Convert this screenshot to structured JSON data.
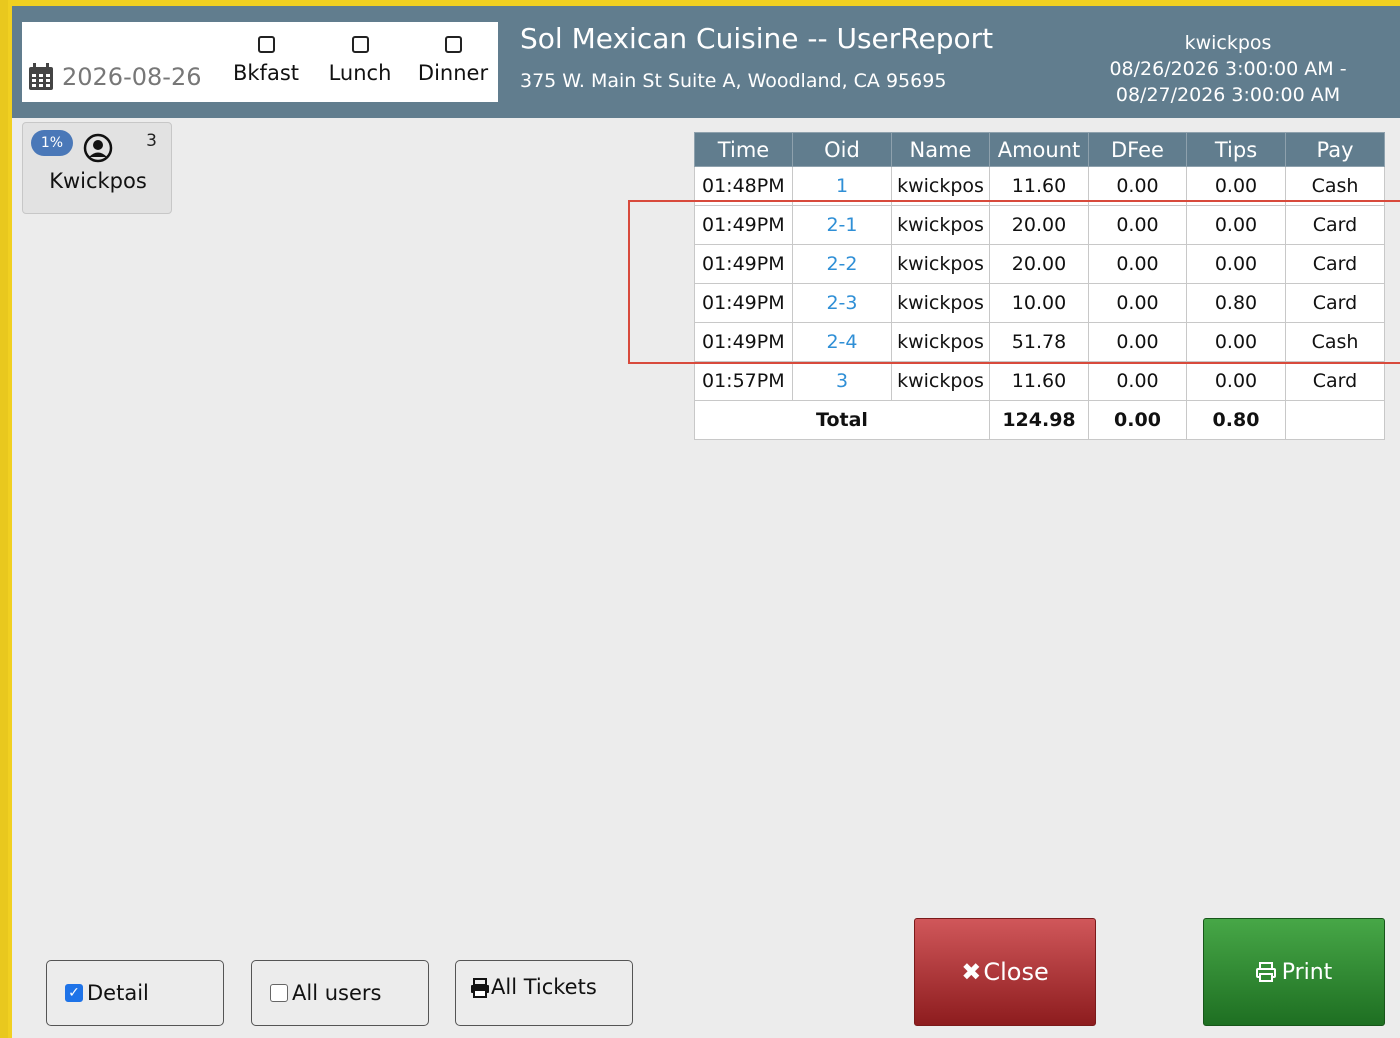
{
  "controls": {
    "date": "2026-08-26",
    "shifts": [
      {
        "label": "Bkfast",
        "checked": false
      },
      {
        "label": "Lunch",
        "checked": false
      },
      {
        "label": "Dinner",
        "checked": false
      }
    ]
  },
  "header": {
    "title": "Sol Mexican Cuisine -- UserReport",
    "address": "375 W. Main St Suite A, Woodland, CA 95695",
    "user": "kwickpos",
    "range_start": "08/26/2026 3:00:00 AM -",
    "range_end": "08/27/2026 3:00:00 AM"
  },
  "user_card": {
    "percent": "1%",
    "count": "3",
    "name": "Kwickpos"
  },
  "table": {
    "headers": [
      "Time",
      "Oid",
      "Name",
      "Amount",
      "DFee",
      "Tips",
      "Pay"
    ],
    "rows": [
      [
        "01:48PM",
        "1",
        "kwickpos",
        "11.60",
        "0.00",
        "0.00",
        "Cash"
      ],
      [
        "01:49PM",
        "2-1",
        "kwickpos",
        "20.00",
        "0.00",
        "0.00",
        "Card"
      ],
      [
        "01:49PM",
        "2-2",
        "kwickpos",
        "20.00",
        "0.00",
        "0.00",
        "Card"
      ],
      [
        "01:49PM",
        "2-3",
        "kwickpos",
        "10.00",
        "0.00",
        "0.80",
        "Card"
      ],
      [
        "01:49PM",
        "2-4",
        "kwickpos",
        "51.78",
        "0.00",
        "0.00",
        "Cash"
      ],
      [
        "01:57PM",
        "3",
        "kwickpos",
        "11.60",
        "0.00",
        "0.00",
        "Card"
      ]
    ],
    "total": {
      "label": "Total",
      "amount": "124.98",
      "dfee": "0.00",
      "tips": "0.80",
      "pay": ""
    }
  },
  "footer": {
    "detail_label": "Detail",
    "detail_checked": true,
    "all_users_label": "All users",
    "all_users_checked": false,
    "all_tickets_label": "All Tickets",
    "close_label": "Close",
    "print_label": "Print"
  },
  "colors": {
    "header_bg": "#617d8e",
    "oid_link": "#2f8fd6",
    "close_red": "#a8292b",
    "print_green": "#2f8a31",
    "highlight_box": "#d84a3c"
  }
}
